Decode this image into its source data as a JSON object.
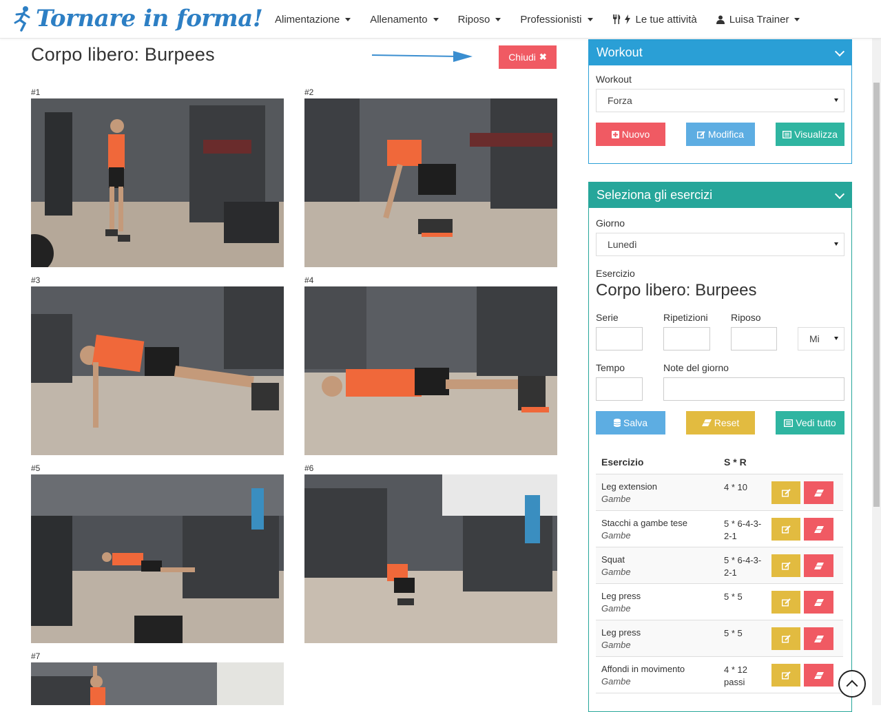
{
  "brand": {
    "name": "Tornare in forma!"
  },
  "nav": {
    "items": [
      {
        "label": "Alimentazione"
      },
      {
        "label": "Allenamento"
      },
      {
        "label": "Riposo"
      },
      {
        "label": "Professionisti"
      }
    ],
    "activities": "Le tue attività",
    "user": "Luisa Trainer"
  },
  "main": {
    "title": "Corpo libero: Burpees",
    "close_label": "Chiudi",
    "thumbs": [
      "#1",
      "#2",
      "#3",
      "#4",
      "#5",
      "#6",
      "#7"
    ]
  },
  "workout_panel": {
    "header": "Workout",
    "label": "Workout",
    "selected": "Forza",
    "buttons": {
      "new": "Nuovo",
      "edit": "Modifica",
      "view": "Visualizza"
    }
  },
  "exercise_panel": {
    "header": "Seleziona gli esercizi",
    "day_label": "Giorno",
    "day_selected": "Lunedì",
    "exercise_label": "Esercizio",
    "exercise_name": "Corpo libero: Burpees",
    "serie_label": "Serie",
    "ripetizioni_label": "Ripetizioni",
    "riposo_label": "Riposo",
    "riposo_unit": "Mi",
    "tempo_label": "Tempo",
    "note_label": "Note del giorno",
    "buttons": {
      "save": "Salva",
      "reset": "Reset",
      "all": "Vedi tutto"
    },
    "table": {
      "headers": {
        "exercise": "Esercizio",
        "sr": "S * R"
      },
      "rows": [
        {
          "name": "Leg extension",
          "cat": "Gambe",
          "sr": "4 * 10"
        },
        {
          "name": "Stacchi a gambe tese",
          "cat": "Gambe",
          "sr": "5 * 6-4-3-2-1"
        },
        {
          "name": "Squat",
          "cat": "Gambe",
          "sr": "5 * 6-4-3-2-1"
        },
        {
          "name": "Leg press",
          "cat": "Gambe",
          "sr": "5 * 5"
        },
        {
          "name": "Leg press",
          "cat": "Gambe",
          "sr": "5 * 5"
        },
        {
          "name": "Affondi in movimento",
          "cat": "Gambe",
          "sr": "4 * 12 passi"
        }
      ]
    }
  },
  "colors": {
    "brand": "#2d7fc4",
    "workout_header": "#2a9fd6",
    "exercise_header": "#26a69a",
    "red": "#f05a63",
    "blue": "#5dade2",
    "teal": "#2fb5a1",
    "gold": "#e2bb40"
  }
}
